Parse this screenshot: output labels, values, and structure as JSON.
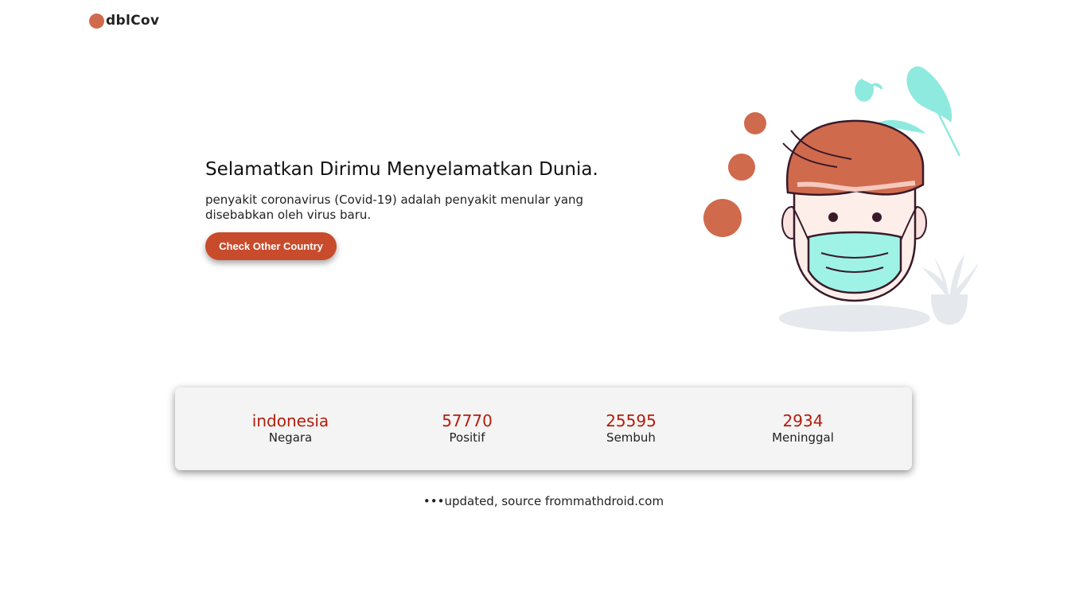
{
  "brand": {
    "name": "dblCov",
    "accent": "#d06a4d"
  },
  "hero": {
    "title": "Selamatkan Dirimu Menyelamatkan Dunia.",
    "description": "penyakit coronavirus (Covid-19) adalah penyakit menular yang disebabkan oleh virus baru.",
    "button_label": "Check Other Country",
    "button_color": "#c84b2c"
  },
  "stats": [
    {
      "value": "indonesia",
      "label": "Negara"
    },
    {
      "value": "57770",
      "label": "Positif"
    },
    {
      "value": "25595",
      "label": "Sembuh"
    },
    {
      "value": "2934",
      "label": "Meninggal"
    }
  ],
  "stat_value_color": "#b31d0c",
  "footer": {
    "note": "•••updated, source frommathdroid.com"
  }
}
